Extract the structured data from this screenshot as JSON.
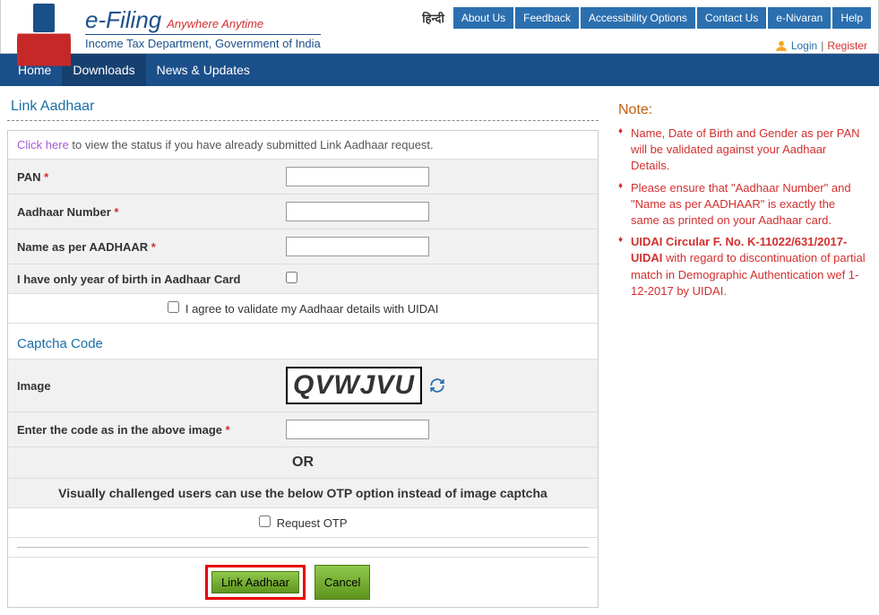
{
  "header": {
    "efiling": "e-Filing",
    "tagline": "Anywhere Anytime",
    "subtitle": "Income Tax Department, Government of India",
    "hindi": "हिन्दी",
    "topnav": {
      "about": "About Us",
      "feedback": "Feedback",
      "accessibility": "Accessibility Options",
      "contact": "Contact Us",
      "enivaran": "e-Nivaran",
      "help": "Help"
    },
    "login": "Login",
    "sep": "|",
    "register": "Register"
  },
  "mainnav": {
    "home": "Home",
    "downloads": "Downloads",
    "news": "News & Updates"
  },
  "page": {
    "title": "Link Aadhaar",
    "click_here": "Click here",
    "instr_rest": " to view the status if you have already submitted Link Aadhaar request.",
    "labels": {
      "pan": "PAN",
      "aadhaar": "Aadhaar Number",
      "name": "Name as per AADHAAR",
      "yob": "I have only year of birth in Aadhaar Card",
      "agree": "I agree to validate my Aadhaar details with UIDAI",
      "captcha_head": "Captcha Code",
      "image": "Image",
      "enter_code": "Enter the code as in the above image",
      "or": "OR",
      "vc": "Visually challenged users can use the below OTP option instead of image captcha",
      "request_otp": "Request OTP"
    },
    "captcha_value": "QVWJVU",
    "buttons": {
      "link": "Link Aadhaar",
      "cancel": "Cancel"
    }
  },
  "notes": {
    "title": "Note:",
    "items": [
      "Name, Date of Birth and Gender as per PAN will be validated against your Aadhaar Details.",
      "Please ensure that \"Aadhaar Number\" and \"Name as per AADHAAR\" is exactly the same as printed on your Aadhaar card."
    ],
    "circular_bold": "UIDAI Circular F. No. K-11022/631/2017-UIDAI",
    "circular_rest": " with regard to discontinuation of partial match in Demographic Authentication wef 1-12-2017 by UIDAI."
  }
}
